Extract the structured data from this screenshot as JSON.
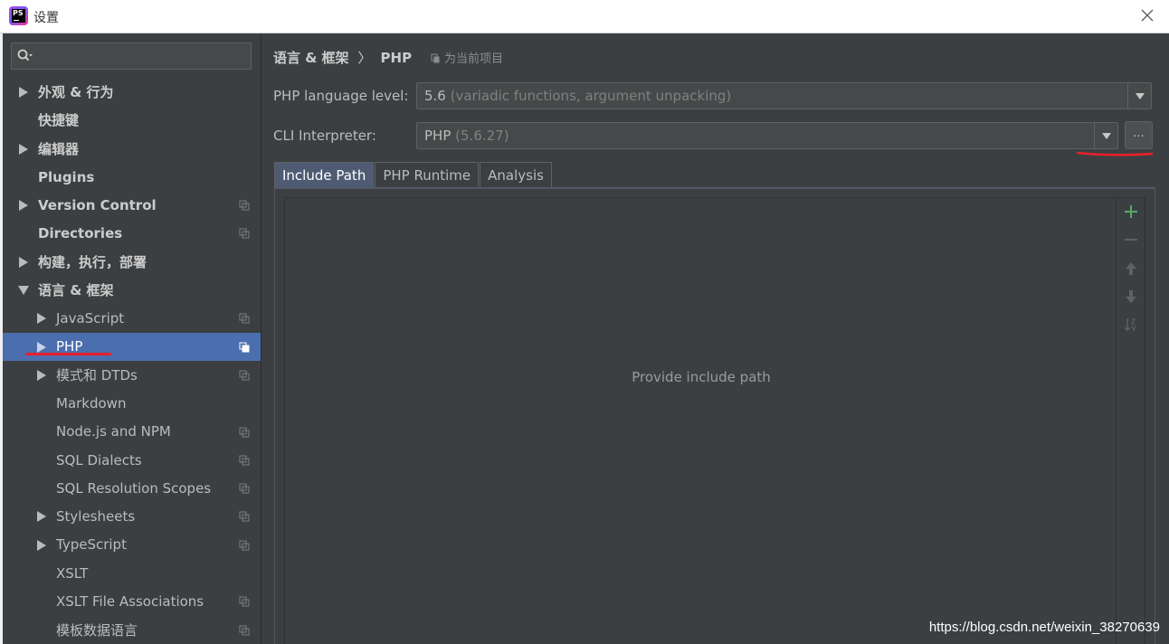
{
  "window": {
    "title": "设置",
    "logo_text": "PS"
  },
  "sidebar": {
    "search": {
      "value": "",
      "placeholder": ""
    },
    "items": [
      {
        "label": "外观 & 行为",
        "expandable": true,
        "expanded": false,
        "level": 0,
        "bold": true,
        "scoped": false
      },
      {
        "label": "快捷键",
        "expandable": false,
        "level": 0,
        "bold": true,
        "scoped": false
      },
      {
        "label": "编辑器",
        "expandable": true,
        "expanded": false,
        "level": 0,
        "bold": true,
        "scoped": false
      },
      {
        "label": "Plugins",
        "expandable": false,
        "level": 0,
        "bold": true,
        "scoped": false
      },
      {
        "label": "Version Control",
        "expandable": true,
        "expanded": false,
        "level": 0,
        "bold": true,
        "scoped": true
      },
      {
        "label": "Directories",
        "expandable": false,
        "level": 0,
        "bold": true,
        "scoped": true
      },
      {
        "label": "构建，执行，部署",
        "expandable": true,
        "expanded": false,
        "level": 0,
        "bold": true,
        "scoped": false
      },
      {
        "label": "语言 & 框架",
        "expandable": true,
        "expanded": true,
        "level": 0,
        "bold": true,
        "scoped": false
      },
      {
        "label": "JavaScript",
        "expandable": true,
        "expanded": false,
        "level": 1,
        "bold": false,
        "scoped": true
      },
      {
        "label": "PHP",
        "expandable": true,
        "expanded": false,
        "level": 1,
        "bold": false,
        "scoped": true,
        "selected": true
      },
      {
        "label": "模式和 DTDs",
        "expandable": true,
        "expanded": false,
        "level": 1,
        "bold": false,
        "scoped": true
      },
      {
        "label": "Markdown",
        "expandable": false,
        "level": 1,
        "bold": false,
        "scoped": false
      },
      {
        "label": "Node.js and NPM",
        "expandable": false,
        "level": 1,
        "bold": false,
        "scoped": true
      },
      {
        "label": "SQL Dialects",
        "expandable": false,
        "level": 1,
        "bold": false,
        "scoped": true
      },
      {
        "label": "SQL Resolution Scopes",
        "expandable": false,
        "level": 1,
        "bold": false,
        "scoped": true
      },
      {
        "label": "Stylesheets",
        "expandable": true,
        "expanded": false,
        "level": 1,
        "bold": false,
        "scoped": true
      },
      {
        "label": "TypeScript",
        "expandable": true,
        "expanded": false,
        "level": 1,
        "bold": false,
        "scoped": true
      },
      {
        "label": "XSLT",
        "expandable": false,
        "level": 1,
        "bold": false,
        "scoped": false
      },
      {
        "label": "XSLT File Associations",
        "expandable": false,
        "level": 1,
        "bold": false,
        "scoped": true
      },
      {
        "label": "模板数据语言",
        "expandable": false,
        "level": 1,
        "bold": false,
        "scoped": true
      }
    ]
  },
  "main": {
    "breadcrumb": {
      "parent": "语言 & 框架",
      "separator": "〉",
      "current": "PHP"
    },
    "scope_label": "为当前项目",
    "language_level": {
      "label": "PHP language level:",
      "value": "5.6",
      "hint": "(variadic functions, argument unpacking)"
    },
    "cli_interpreter": {
      "label": "CLI Interpreter:",
      "value": "PHP",
      "hint": "(5.6.27)",
      "more_label": "..."
    },
    "tabs": [
      {
        "label": "Include Path",
        "active": true
      },
      {
        "label": "PHP Runtime",
        "active": false
      },
      {
        "label": "Analysis",
        "active": false
      }
    ],
    "include_path": {
      "empty_text": "Provide include path"
    }
  },
  "colors": {
    "accent_selection": "#4b6eaf",
    "active_tab": "#4e5b73",
    "add_green": "#59a869",
    "annotation_red": "#e8202a",
    "background": "#3c3f41"
  },
  "icons": [
    "search-icon",
    "close-icon",
    "expand-arrow-icon",
    "collapse-arrow-icon",
    "copy-scope-icon",
    "chevron-down-icon",
    "add-icon",
    "remove-icon",
    "move-up-icon",
    "move-down-icon",
    "sort-icon"
  ],
  "watermark": "https://blog.csdn.net/weixin_38270639"
}
